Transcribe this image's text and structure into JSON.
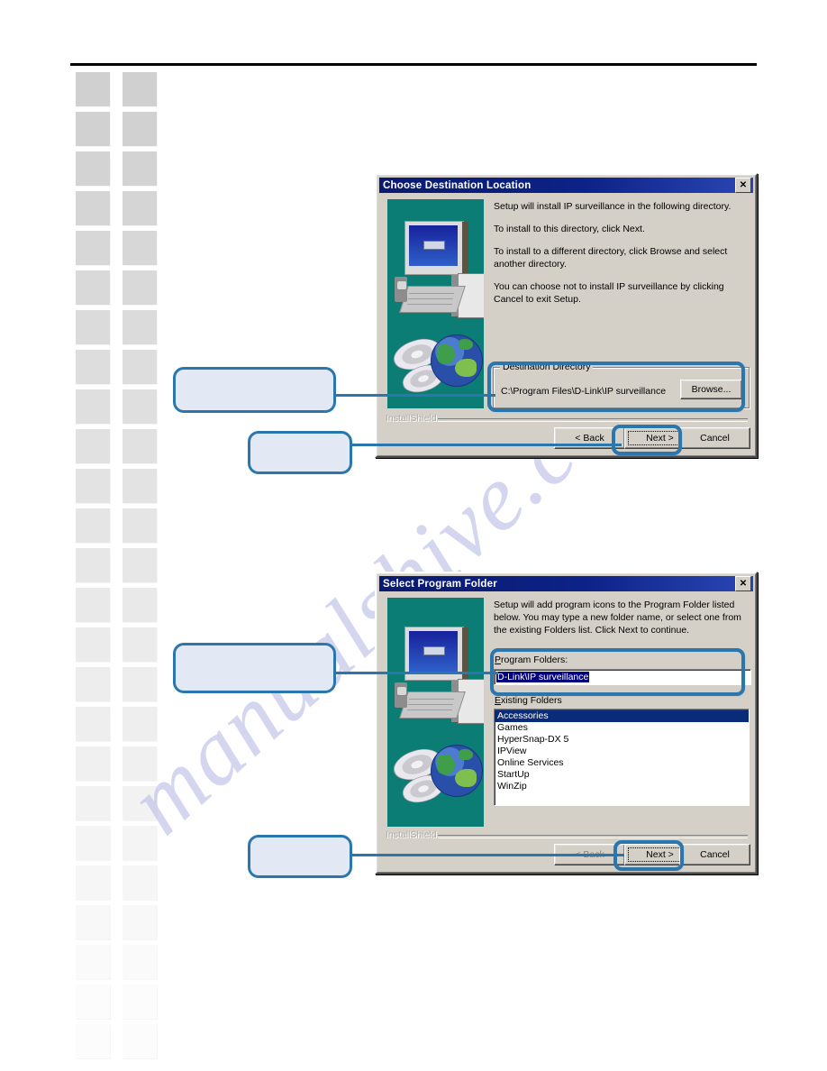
{
  "page": {
    "watermark_text": "manualshive.com",
    "accent_color": "#2b77ad",
    "callout_fill": "#e3e9f4",
    "dialog_face": "#d4d0c8",
    "titlebar_color": "#000080",
    "artwork_background": "#0b7d74"
  },
  "dialog1": {
    "title": "Choose Destination Location",
    "close_label": "✕",
    "paragraphs": [
      "Setup will install IP surveillance in the following directory.",
      "To install to this directory, click Next.",
      "To install to a different directory, click Browse and select another directory.",
      "You can choose not to install IP surveillance by clicking Cancel to exit Setup."
    ],
    "group_legend": "Destination Directory",
    "destination_path": "C:\\Program Files\\D-Link\\IP surveillance",
    "browse_label": "Browse...",
    "installshield_label": "InstallShield",
    "buttons": {
      "back": "< Back",
      "next": "Next >",
      "cancel": "Cancel"
    }
  },
  "dialog2": {
    "title": "Select Program Folder",
    "close_label": "✕",
    "paragraphs": [
      "Setup will add program icons to the Program Folder listed below. You may type a new folder name, or select one from the existing Folders list.  Click Next to continue."
    ],
    "program_folders_label": "Program Folders:",
    "program_folder_value": "D-Link\\IP surveillance",
    "existing_folders_label": "Existing Folders",
    "existing_folders": [
      "Accessories",
      "Games",
      "HyperSnap-DX 5",
      "IPView",
      "Online Services",
      "StartUp",
      "WinZip"
    ],
    "selected_folder_index": 0,
    "installshield_label": "InstallShield",
    "buttons": {
      "back": "< Back",
      "next": "Next >",
      "cancel": "Cancel"
    }
  },
  "callouts": [
    {
      "id": "callout-destination-directory",
      "text": ""
    },
    {
      "id": "callout-next-1",
      "text": ""
    },
    {
      "id": "callout-program-folders",
      "text": ""
    },
    {
      "id": "callout-next-2",
      "text": ""
    }
  ]
}
